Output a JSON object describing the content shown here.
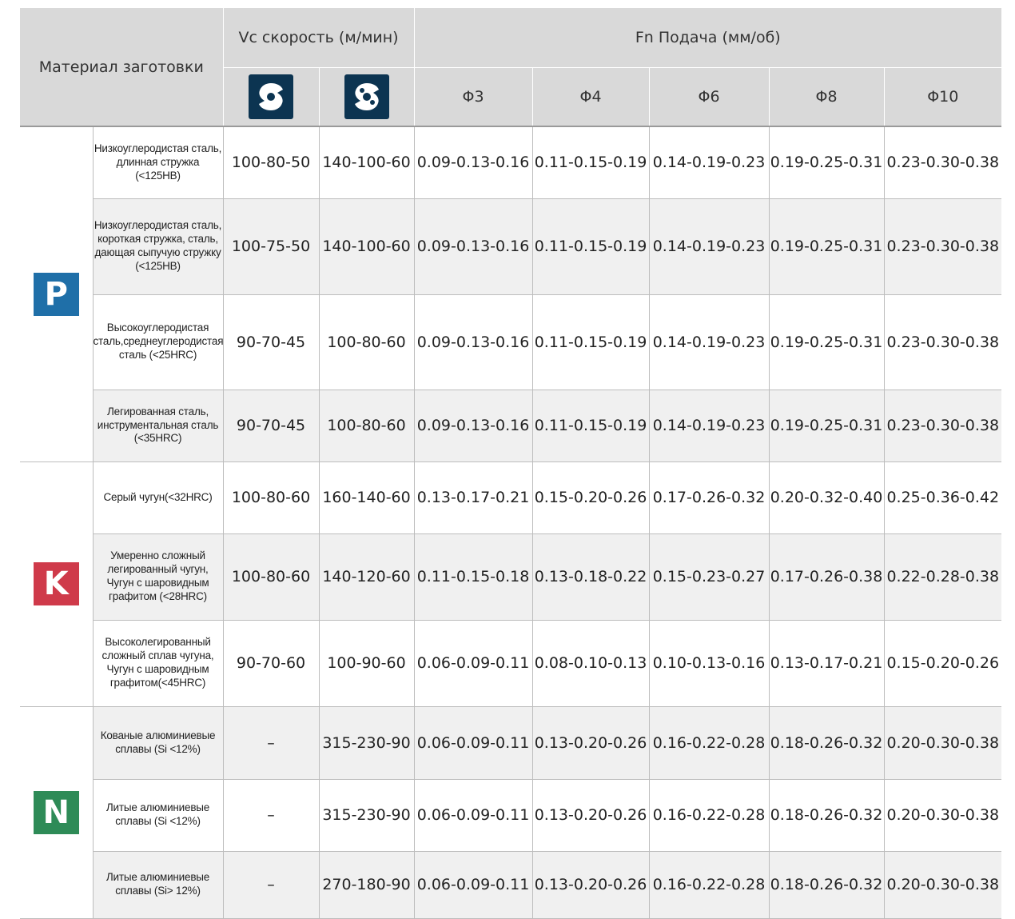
{
  "header": {
    "material": "Материал заготовки",
    "vc": "Vc скорость (м/мин)",
    "fn": "Fn  Подача (мм/об)",
    "diameters": [
      "Φ3",
      "Φ4",
      "Φ6",
      "Φ8",
      "Φ10"
    ],
    "icons": [
      "insert-solid-icon",
      "insert-coolant-holes-icon"
    ]
  },
  "colors": {
    "P": "#1f6fa8",
    "K": "#cf3a4a",
    "N": "#2e8b57",
    "icon_bg": "#0c3451",
    "header_bg": "#d9d9d9"
  },
  "groups": [
    {
      "letter": "P",
      "rows": [
        {
          "desc": "Низкоуглеродистая сталь, длинная стружка (<125HB)",
          "vc1": "100-80-50",
          "vc2": "140-100-60",
          "f": [
            "0.09-0.13-0.16",
            "0.11-0.15-0.19",
            "0.14-0.19-0.23",
            "0.19-0.25-0.31",
            "0.23-0.30-0.38"
          ]
        },
        {
          "desc": "Низкоуглеродистая сталь, короткая стружка, сталь, дающая сыпучую стружку (<125HB)",
          "vc1": "100-75-50",
          "vc2": "140-100-60",
          "f": [
            "0.09-0.13-0.16",
            "0.11-0.15-0.19",
            "0.14-0.19-0.23",
            "0.19-0.25-0.31",
            "0.23-0.30-0.38"
          ]
        },
        {
          "desc": "Высокоуглеродистая сталь,среднеуглеродистая сталь (<25HRC)",
          "vc1": "90-70-45",
          "vc2": "100-80-60",
          "f": [
            "0.09-0.13-0.16",
            "0.11-0.15-0.19",
            "0.14-0.19-0.23",
            "0.19-0.25-0.31",
            "0.23-0.30-0.38"
          ]
        },
        {
          "desc": "Легированная сталь, инструментальная сталь (<35HRC)",
          "vc1": "90-70-45",
          "vc2": "100-80-60",
          "f": [
            "0.09-0.13-0.16",
            "0.11-0.15-0.19",
            "0.14-0.19-0.23",
            "0.19-0.25-0.31",
            "0.23-0.30-0.38"
          ]
        }
      ]
    },
    {
      "letter": "K",
      "rows": [
        {
          "desc": "Серый чугун(<32HRC)",
          "vc1": "100-80-60",
          "vc2": "160-140-60",
          "f": [
            "0.13-0.17-0.21",
            "0.15-0.20-0.26",
            "0.17-0.26-0.32",
            "0.20-0.32-0.40",
            "0.25-0.36-0.42"
          ]
        },
        {
          "desc": "Умеренно сложный легированный чугун, Чугун с шаровидным графитом (<28HRC)",
          "vc1": "100-80-60",
          "vc2": "140-120-60",
          "f": [
            "0.11-0.15-0.18",
            "0.13-0.18-0.22",
            "0.15-0.23-0.27",
            "0.17-0.26-0.38",
            "0.22-0.28-0.38"
          ]
        },
        {
          "desc": "Высоколегированный сложный сплав чугуна, Чугун с шаровидным графитом(<45HRC)",
          "vc1": "90-70-60",
          "vc2": "100-90-60",
          "f": [
            "0.06-0.09-0.11",
            "0.08-0.10-0.13",
            "0.10-0.13-0.16",
            "0.13-0.17-0.21",
            "0.15-0.20-0.26"
          ]
        }
      ]
    },
    {
      "letter": "N",
      "rows": [
        {
          "desc": "Кованые алюминиевые сплавы (Si <12%)",
          "vc1": "–",
          "vc2": "315-230-90",
          "f": [
            "0.06-0.09-0.11",
            "0.13-0.20-0.26",
            "0.16-0.22-0.28",
            "0.18-0.26-0.32",
            "0.20-0.30-0.38"
          ]
        },
        {
          "desc": "Литые алюминиевые сплавы (Si <12%)",
          "vc1": "–",
          "vc2": "315-230-90",
          "f": [
            "0.06-0.09-0.11",
            "0.13-0.20-0.26",
            "0.16-0.22-0.28",
            "0.18-0.26-0.32",
            "0.20-0.30-0.38"
          ]
        },
        {
          "desc": "Литые алюминиевые сплавы (Si> 12%)",
          "vc1": "–",
          "vc2": "270-180-90",
          "f": [
            "0.06-0.09-0.11",
            "0.13-0.20-0.26",
            "0.16-0.22-0.28",
            "0.18-0.26-0.32",
            "0.20-0.30-0.38"
          ]
        }
      ]
    }
  ]
}
